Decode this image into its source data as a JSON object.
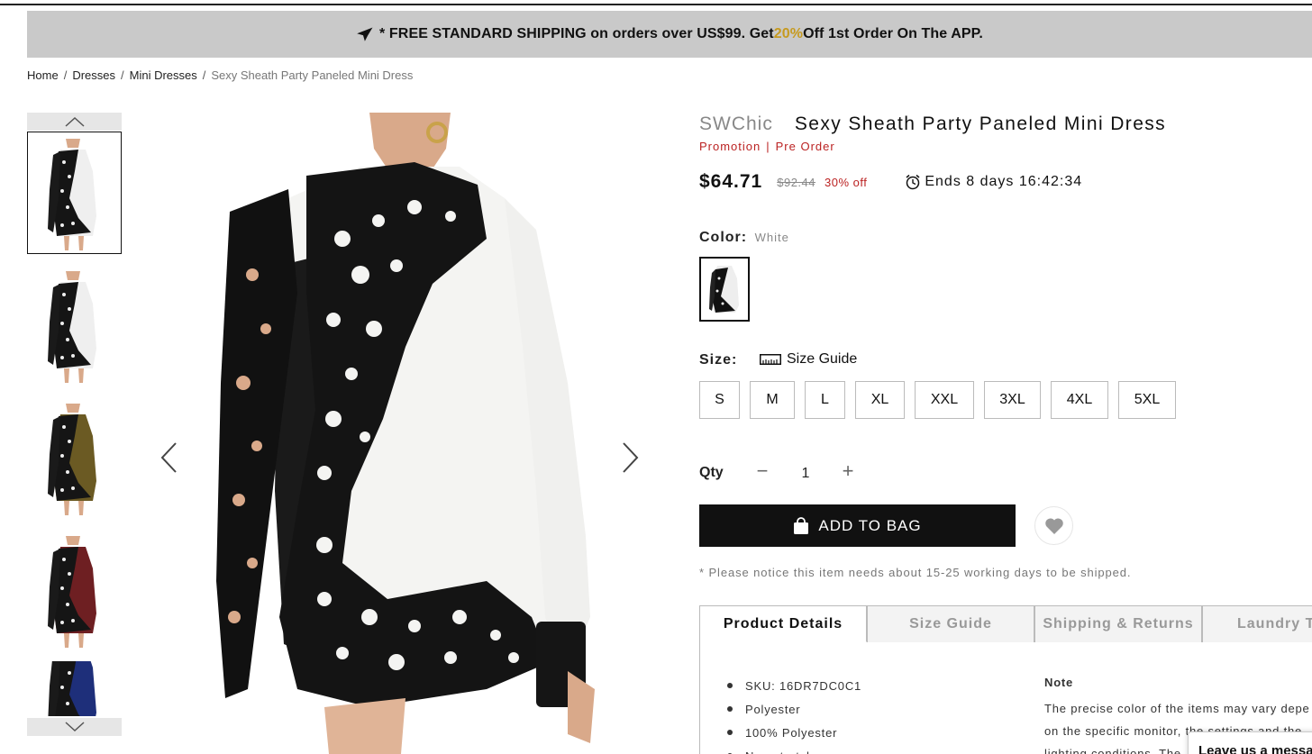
{
  "banner": {
    "prefix": "* FREE STANDARD SHIPPING on orders over US$99. Get ",
    "highlight": "20%",
    "suffix": " Off 1st Order On The APP."
  },
  "breadcrumb": [
    {
      "label": "Home"
    },
    {
      "label": "Dresses"
    },
    {
      "label": "Mini Dresses"
    },
    {
      "label": "Sexy Sheath Party Paneled Mini Dress"
    }
  ],
  "gallery": {
    "thumbnails": [
      {
        "color": "white",
        "accent": "#efefef"
      },
      {
        "color": "white",
        "accent": "#efefef"
      },
      {
        "color": "olive",
        "accent": "#6b5a23"
      },
      {
        "color": "burgundy",
        "accent": "#6e1f22"
      },
      {
        "color": "navy",
        "accent": "#1e2f7a"
      }
    ]
  },
  "product": {
    "brand": "SWChic",
    "title": "Sexy Sheath Party Paneled Mini Dress",
    "tags": [
      "Promotion",
      "Pre Order"
    ],
    "price": "$64.71",
    "old_price": "$92.44",
    "discount": "30% off",
    "timer": "Ends 8 days 16:42:34",
    "color_label": "Color:",
    "color_value": "White",
    "size_label": "Size:",
    "size_guide_label": "Size Guide",
    "sizes": [
      "S",
      "M",
      "L",
      "XL",
      "XXL",
      "3XL",
      "4XL",
      "5XL"
    ],
    "qty_label": "Qty",
    "qty_minus": "−",
    "qty_value": "1",
    "qty_plus": "+",
    "add_to_bag": "ADD TO BAG",
    "notice": "* Please notice this item needs about 15-25 working days to be shipped."
  },
  "tabs": [
    "Product Details",
    "Size Guide",
    "Shipping & Returns",
    "Laundry T"
  ],
  "details": {
    "items": [
      "SKU: 16DR7DC0C1",
      "Polyester",
      "100% Polyester",
      "Non-stretchy"
    ],
    "note_head": "Note",
    "note_lines": [
      "The precise color of the items may vary depe",
      "on the specific monitor, the settings and the",
      "lighting conditions. The"
    ]
  },
  "chat": {
    "label": "Leave us a messa"
  },
  "colors": {
    "accent": "#c69a1f",
    "promo": "#b22222",
    "banner_bg": "#c9c9c9"
  }
}
